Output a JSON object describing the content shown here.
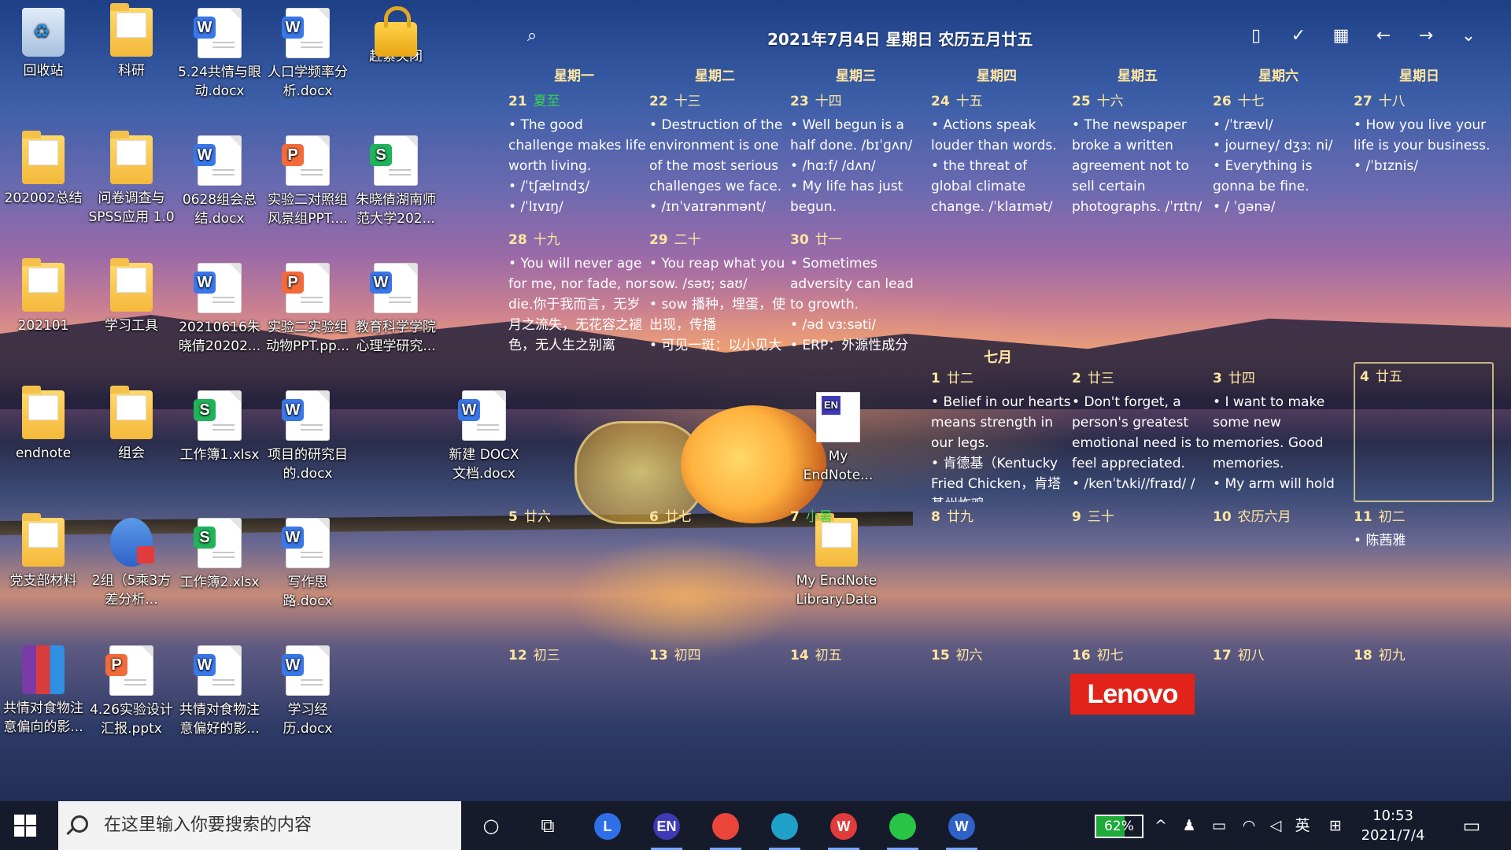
{
  "desktop_icons": [
    {
      "label": "回收站",
      "kind": "bin",
      "col": 0,
      "row": 0
    },
    {
      "label": "科研",
      "kind": "folder",
      "col": 1,
      "row": 0
    },
    {
      "label": "5.24共情与眼动.docx",
      "kind": "word",
      "col": 2,
      "row": 0
    },
    {
      "label": "人口学频率分析.docx",
      "kind": "word",
      "col": 3,
      "row": 0
    },
    {
      "label": "赶紧关闭",
      "kind": "lock",
      "col": 4,
      "row": 0
    },
    {
      "label": "202002总结",
      "kind": "folder",
      "col": 0,
      "row": 1
    },
    {
      "label": "问卷调查与SPSS应用 1.0",
      "kind": "folder",
      "col": 1,
      "row": 1
    },
    {
      "label": "0628组会总结.docx",
      "kind": "word",
      "col": 2,
      "row": 1
    },
    {
      "label": "实验二对照组风景组PPT....",
      "kind": "ppt",
      "col": 3,
      "row": 1
    },
    {
      "label": "朱晓倩湖南师范大学202...",
      "kind": "excel",
      "col": 4,
      "row": 1
    },
    {
      "label": "202101",
      "kind": "folder",
      "col": 0,
      "row": 2
    },
    {
      "label": "学习工具",
      "kind": "folder",
      "col": 1,
      "row": 2
    },
    {
      "label": "20210616朱晓倩20202...",
      "kind": "word",
      "col": 2,
      "row": 2
    },
    {
      "label": "实验二实验组动物PPT.pp...",
      "kind": "ppt",
      "col": 3,
      "row": 2
    },
    {
      "label": "教育科学学院心理学研究...",
      "kind": "word",
      "col": 4,
      "row": 2
    },
    {
      "label": "endnote",
      "kind": "folder",
      "col": 0,
      "row": 3
    },
    {
      "label": "组会",
      "kind": "folder",
      "col": 1,
      "row": 3
    },
    {
      "label": "工作簿1.xlsx",
      "kind": "excel",
      "col": 2,
      "row": 3
    },
    {
      "label": "项目的研究目的.docx",
      "kind": "word",
      "col": 3,
      "row": 3
    },
    {
      "label": "新建 DOCX 文档.docx",
      "kind": "word",
      "col": 5,
      "row": 3
    },
    {
      "label": "党支部材料",
      "kind": "folder",
      "col": 0,
      "row": 4
    },
    {
      "label": "2组（5乘3方差分析...",
      "kind": "calc",
      "col": 1,
      "row": 4
    },
    {
      "label": "工作簿2.xlsx",
      "kind": "excel",
      "col": 2,
      "row": 4
    },
    {
      "label": "写作思路.docx",
      "kind": "word",
      "col": 3,
      "row": 4
    },
    {
      "label": "共情对食物注意偏向的影...",
      "kind": "winrar",
      "col": 0,
      "row": 5
    },
    {
      "label": "4.26实验设计汇报.pptx",
      "kind": "ppt",
      "col": 1,
      "row": 5
    },
    {
      "label": "共情对食物注意偏好的影...",
      "kind": "word",
      "col": 2,
      "row": 5
    },
    {
      "label": "学习经历.docx",
      "kind": "word",
      "col": 3,
      "row": 5
    }
  ],
  "floating_icons": [
    {
      "label": "My EndNote...",
      "kind": "en"
    },
    {
      "label": "My EndNote Library.Data",
      "kind": "folder"
    }
  ],
  "calendar": {
    "title": "2021年7月4日 星期日 农历五月廿五",
    "weekdays": [
      "星期一",
      "星期二",
      "星期三",
      "星期四",
      "星期五",
      "星期六",
      "星期日"
    ],
    "july_label": "七月",
    "week1": [
      {
        "day": "21",
        "lunar": "夏至",
        "term": true,
        "notes": [
          "The good challenge makes life worth living.",
          "/ˈtʃælɪndʒ/",
          "/ˈlɪvɪŋ/"
        ]
      },
      {
        "day": "22",
        "lunar": "十三",
        "notes": [
          "Destruction of the environment is one of the most serious challenges we face.",
          "/ɪnˈvaɪrənmənt/"
        ]
      },
      {
        "day": "23",
        "lunar": "十四",
        "notes": [
          "Well begun is a half done. /bɪˈɡʌn/",
          "/hɑːf/ /dʌn/",
          "My life has just begun."
        ]
      },
      {
        "day": "24",
        "lunar": "十五",
        "notes": [
          "Actions speak louder than words.",
          "the threat of global climate change. /ˈklaɪmət/"
        ]
      },
      {
        "day": "25",
        "lunar": "十六",
        "notes": [
          "The newspaper broke a written agreement not to sell certain photographs. /ˈrɪtn/"
        ]
      },
      {
        "day": "26",
        "lunar": "十七",
        "notes": [
          "/ˈtrævl/",
          "journey/ dʒɜː ni/",
          "Everything is gonna be fine.",
          "/ ˈɡənə/"
        ]
      },
      {
        "day": "27",
        "lunar": "十八",
        "notes": [
          "How you live your life is your business.",
          "/ˈbɪznis/"
        ]
      }
    ],
    "week2": [
      {
        "day": "28",
        "lunar": "十九",
        "notes": [
          "You will never age for me, nor fade, nor die.你于我而言，无岁月之流失，无花容之褪色，无人生之别离"
        ]
      },
      {
        "day": "29",
        "lunar": "二十",
        "notes": [
          "You reap what you sow. /səʊ; saʊ/",
          "sow 播种，埋蛋，使出现，传播",
          "可见一斑：以小见大"
        ]
      },
      {
        "day": "30",
        "lunar": "廿一",
        "notes": [
          "Sometimes adversity can lead to growth.",
          "/əd vɜːsəti/",
          "ERP：外源性成分"
        ]
      },
      {
        "day": "",
        "lunar": "",
        "notes": []
      },
      {
        "day": "",
        "lunar": "",
        "notes": []
      },
      {
        "day": "",
        "lunar": "",
        "notes": []
      },
      {
        "day": "",
        "lunar": "",
        "notes": []
      }
    ],
    "week3": [
      {
        "day": "",
        "lunar": "",
        "notes": []
      },
      {
        "day": "",
        "lunar": "",
        "notes": []
      },
      {
        "day": "",
        "lunar": "",
        "notes": []
      },
      {
        "day": "1",
        "lunar": "廿二",
        "notes": [
          "Belief in our hearts means strength in our legs.",
          "肯德基（Kentucky Fried Chicken，肯塔基州炸鸡"
        ]
      },
      {
        "day": "2",
        "lunar": "廿三",
        "notes": [
          "Don't forget, a person's greatest emotional need is to feel appreciated.",
          "/kenˈtʌki//fraɪd/ /"
        ]
      },
      {
        "day": "3",
        "lunar": "廿四",
        "notes": [
          "I want to make some new memories. Good memories.",
          "My arm will hold"
        ]
      },
      {
        "day": "4",
        "lunar": "廿五",
        "notes": [],
        "today": true
      }
    ],
    "week4": [
      {
        "day": "5",
        "lunar": "廿六",
        "notes": []
      },
      {
        "day": "6",
        "lunar": "廿七",
        "notes": []
      },
      {
        "day": "7",
        "lunar": "小暑",
        "term": true,
        "notes": []
      },
      {
        "day": "8",
        "lunar": "廿九",
        "notes": []
      },
      {
        "day": "9",
        "lunar": "三十",
        "notes": []
      },
      {
        "day": "10",
        "lunar": "农历六月",
        "notes": []
      },
      {
        "day": "11",
        "lunar": "初二",
        "notes": [
          "陈茜雅"
        ]
      }
    ],
    "week5": [
      {
        "day": "12",
        "lunar": "初三",
        "notes": []
      },
      {
        "day": "13",
        "lunar": "初四",
        "notes": []
      },
      {
        "day": "14",
        "lunar": "初五",
        "notes": []
      },
      {
        "day": "15",
        "lunar": "初六",
        "notes": []
      },
      {
        "day": "16",
        "lunar": "初七",
        "notes": []
      },
      {
        "day": "17",
        "lunar": "初八",
        "notes": []
      },
      {
        "day": "18",
        "lunar": "初九",
        "notes": []
      }
    ]
  },
  "wallpaper": {
    "brand": "Lenovo"
  },
  "taskbar": {
    "search_placeholder": "在这里输入你要搜索的内容",
    "battery": "62%",
    "ime": "英",
    "time": "10:53",
    "date": "2021/7/4",
    "apps": [
      {
        "name": "L",
        "color": "#2f6fe8"
      },
      {
        "name": "EN",
        "color": "#3e3ab6"
      },
      {
        "name": "chrome",
        "color": "#e9453a"
      },
      {
        "name": "edge",
        "color": "#1ea0c8"
      },
      {
        "name": "W",
        "color": "#e23b3b"
      },
      {
        "name": "wechat",
        "color": "#28c445"
      },
      {
        "name": "W",
        "color": "#2f62c8"
      }
    ]
  }
}
